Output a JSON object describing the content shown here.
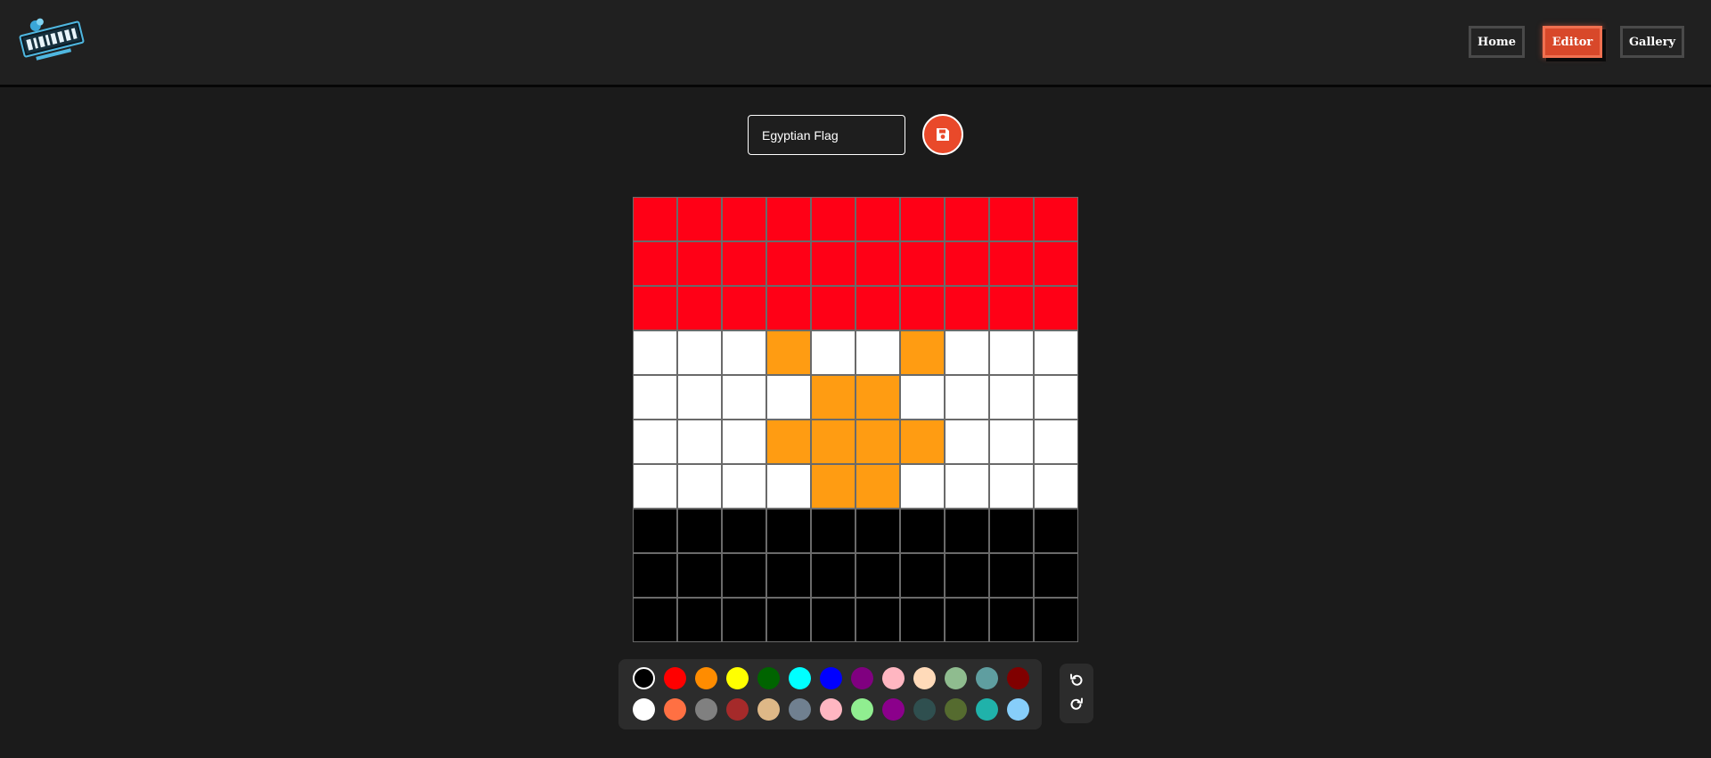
{
  "app": {
    "logo_text": "PIXLRRE",
    "icon": "logo-icon"
  },
  "nav": {
    "items": [
      {
        "label": "Home",
        "active": false
      },
      {
        "label": "Editor",
        "active": true
      },
      {
        "label": "Gallery",
        "active": false
      }
    ]
  },
  "editor": {
    "title_value": "Egyptian Flag",
    "save_icon": "floppy-disk-icon",
    "grid_size": 10,
    "grid": [
      [
        "R",
        "R",
        "R",
        "R",
        "R",
        "R",
        "R",
        "R",
        "R",
        "R"
      ],
      [
        "R",
        "R",
        "R",
        "R",
        "R",
        "R",
        "R",
        "R",
        "R",
        "R"
      ],
      [
        "R",
        "R",
        "R",
        "R",
        "R",
        "R",
        "R",
        "R",
        "R",
        "R"
      ],
      [
        "W",
        "W",
        "W",
        "O",
        "W",
        "W",
        "O",
        "W",
        "W",
        "W"
      ],
      [
        "W",
        "W",
        "W",
        "W",
        "O",
        "O",
        "W",
        "W",
        "W",
        "W"
      ],
      [
        "W",
        "W",
        "W",
        "O",
        "O",
        "O",
        "O",
        "W",
        "W",
        "W"
      ],
      [
        "W",
        "W",
        "W",
        "W",
        "O",
        "O",
        "W",
        "W",
        "W",
        "W"
      ],
      [
        "K",
        "K",
        "K",
        "K",
        "K",
        "K",
        "K",
        "K",
        "K",
        "K"
      ],
      [
        "K",
        "K",
        "K",
        "K",
        "K",
        "K",
        "K",
        "K",
        "K",
        "K"
      ],
      [
        "K",
        "K",
        "K",
        "K",
        "K",
        "K",
        "K",
        "K",
        "K",
        "K"
      ]
    ],
    "grid_colors": {
      "R": "#ff0016",
      "W": "#ffffff",
      "O": "#ff9c12",
      "K": "#000000"
    }
  },
  "palette": {
    "selected_index": 0,
    "row1": [
      "#000000",
      "#ff0000",
      "#ff8c00",
      "#ffff00",
      "#006400",
      "#00ffff",
      "#0000ff",
      "#800080",
      "#ffb6c1",
      "#ffdab9",
      "#8fbc8f",
      "#5f9ea0",
      "#800000"
    ],
    "row2": [
      "#ffffff",
      "#ff7043",
      "#808080",
      "#a52a2a",
      "#deb887",
      "#708090",
      "#ffb6c1",
      "#90ee90",
      "#8b008b",
      "#2f4f4f",
      "#556b2f",
      "#20b2aa",
      "#87cefa"
    ]
  },
  "history": {
    "undo_icon": "undo-icon",
    "redo_icon": "redo-icon"
  }
}
